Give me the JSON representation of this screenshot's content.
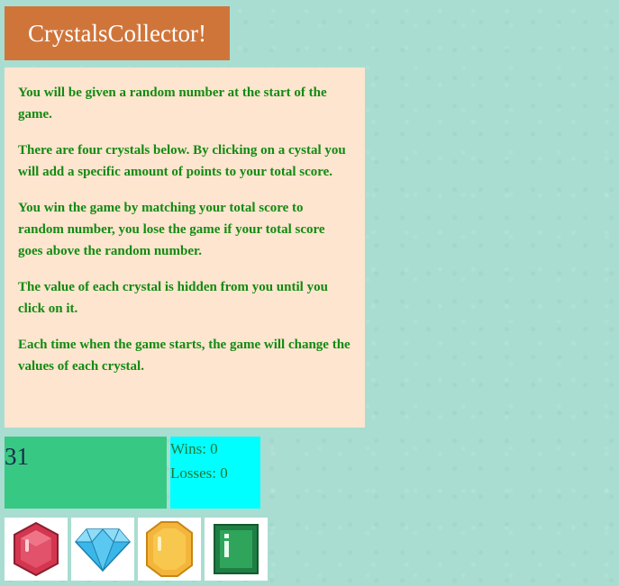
{
  "header": {
    "title": "CrystalsCollector!"
  },
  "instructions": [
    "You will be given a random number at the start of the game.",
    "There are four crystals below. By clicking on a cystal you will add a specific amount of points to your total score.",
    "You win the game by matching your total score to random number, you lose the game if your total score goes above the random number.",
    "The value of each crystal is hidden from you until you click on it.",
    "Each time when the game starts, the game will change the values of each crystal."
  ],
  "game": {
    "random_number": "31",
    "wins": "Wins: 0",
    "losses": "Losses: 0"
  },
  "crystals": [
    {
      "icon": "red-gem-icon",
      "color": "#d4364f"
    },
    {
      "icon": "blue-diamond-icon",
      "color": "#3ab6e8"
    },
    {
      "icon": "yellow-gem-icon",
      "color": "#f4b53b"
    },
    {
      "icon": "green-gem-icon",
      "color": "#2ea55a"
    }
  ],
  "colors": {
    "background": "#a9ddd1",
    "title_bg": "#d0753a",
    "instructions_bg": "#fde5cf",
    "instructions_text": "#138a12",
    "target_bg": "#37c983",
    "score_bg": "#00ffff"
  }
}
